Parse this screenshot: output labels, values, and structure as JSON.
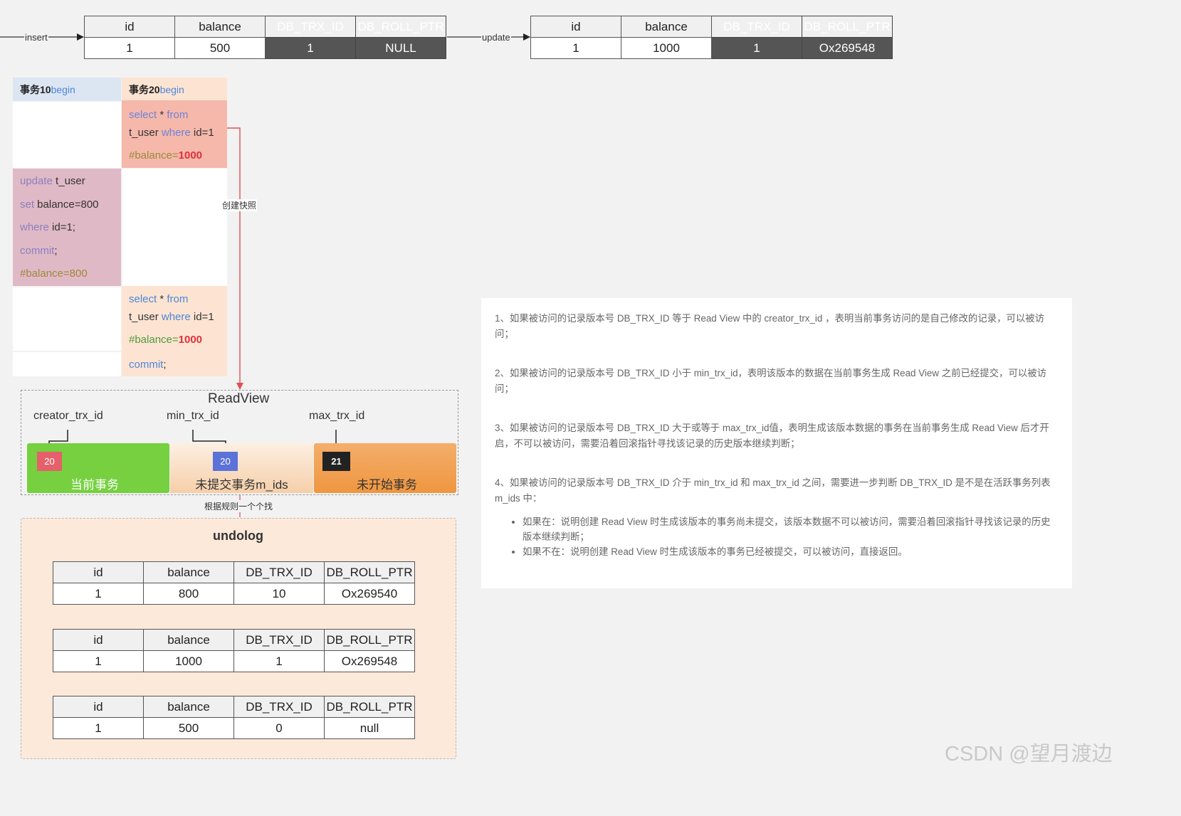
{
  "top_flow": {
    "insert_label": "insert",
    "update_label": "update",
    "columns": [
      "id",
      "balance",
      "DB_TRX_ID",
      "DB_ROLL_PTR"
    ],
    "record_after_insert": [
      "1",
      "500",
      "1",
      "NULL"
    ],
    "record_after_update": [
      "1",
      "1000",
      "1",
      "Ox269548"
    ]
  },
  "transactions": {
    "tx10_header": {
      "title": "事务10",
      "begin": "begin"
    },
    "tx20_header": {
      "title": "事务20",
      "begin": "begin"
    },
    "tx20_select1": {
      "kw1": "select",
      "star": " * ",
      "kw2": "from",
      "table": "t_user ",
      "kw3": "where",
      "cond": " id=1",
      "comment_prefix": "#balance=",
      "comment_value": "1000"
    },
    "tx10_update": {
      "kw_update": "update",
      "table": " t_user",
      "kw_set": "set",
      "set_clause": " balance=800",
      "kw_where": "where",
      "cond": " id=1;",
      "kw_commit": "commit",
      "semicolon": ";",
      "comment": "#balance=800"
    },
    "tx20_select2": {
      "kw1": "select",
      "star": " * ",
      "kw2": "from",
      "table": "t_user ",
      "kw3": "where",
      "cond": " id=1",
      "comment_prefix": "#balance=",
      "comment_value": "1000",
      "kw_commit": "commit",
      "semicolon": ";"
    }
  },
  "snapshot_label": "创建快照",
  "readview": {
    "title": "ReadView",
    "pointers": [
      "creator_trx_id",
      "min_trx_id",
      "max_trx_id"
    ],
    "segments": [
      {
        "badge": "20",
        "label": "当前事务"
      },
      {
        "badge": "20",
        "label": "未提交事务m_ids"
      },
      {
        "badge": "21",
        "label": "未开始事务"
      }
    ]
  },
  "search_rule_label": "根据规则一个个找",
  "undolog": {
    "title": "undolog",
    "columns": [
      "id",
      "balance",
      "DB_TRX_ID",
      "DB_ROLL_PTR"
    ],
    "records": [
      [
        "1",
        "800",
        "10",
        "Ox269540"
      ],
      [
        "1",
        "1000",
        "1",
        "Ox269548"
      ],
      [
        "1",
        "500",
        "0",
        "null"
      ]
    ]
  },
  "rules": {
    "items": [
      "1、如果被访问的记录版本号 DB_TRX_ID 等于 Read View 中的 creator_trx_id ，表明当前事务访问的是自己修改的记录，可以被访问；",
      "2、如果被访问的记录版本号 DB_TRX_ID 小于 min_trx_id，表明该版本的数据在当前事务生成 Read View 之前已经提交，可以被访问；",
      "3、如果被访问的记录版本号 DB_TRX_ID 大于或等于 max_trx_id值，表明生成该版本数据的事务在当前事务生成 Read View 后才开启，不可以被访问，需要沿着回滚指针寻找该记录的历史版本继续判断；",
      "4、如果被访问的记录版本号 DB_TRX_ID 介于 min_trx_id 和 max_trx_id 之间，需要进一步判断 DB_TRX_ID 是不是在活跃事务列表 m_ids 中："
    ],
    "bullets": [
      "如果在：说明创建 Read View 时生成该版本的事务尚未提交，该版本数据不可以被访问，需要沿着回滚指针寻找该记录的历史版本继续判断；",
      "如果不在：说明创建 Read View 时生成该版本的事务已经被提交，可以被访问，直接返回。"
    ]
  },
  "colors": {
    "current_tx": "#76d040",
    "uncommitted_tx": "#fad9b8",
    "not_started_tx": "#f29a44",
    "select_cell": "#f5b8ab",
    "update_cell": "#e0b9c6",
    "tx20_cell": "#fde4d2",
    "arrow_red": "#e05050"
  },
  "watermark": "CSDN @望月渡边"
}
